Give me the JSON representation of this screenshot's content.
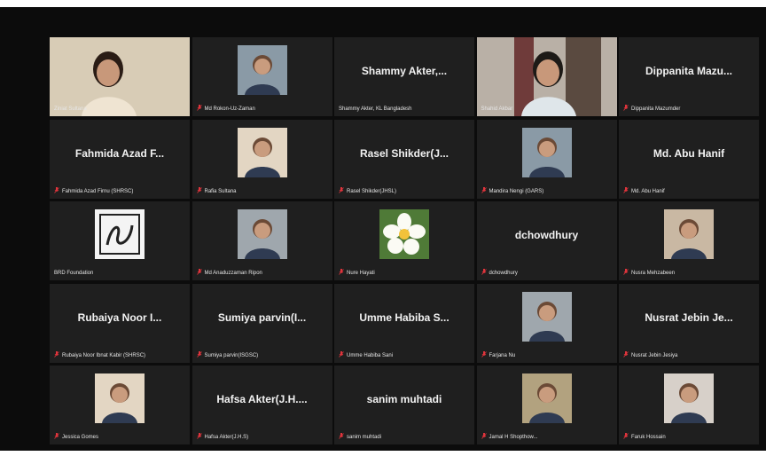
{
  "colors": {
    "background": "#0c0c0c",
    "tile": "#1f1f1f",
    "active_speaker_border": "#b9d35a",
    "muted_mic": "#e0343c"
  },
  "participants": [
    {
      "display": "",
      "label": "Ziniat Sultana",
      "muted": false,
      "video": "photo"
    },
    {
      "display": "",
      "label": "Md Rokon-Uz-Zaman",
      "muted": true,
      "video": "photo"
    },
    {
      "display": "Shammy Akter,...",
      "label": "Shammy Akter, KL Bangladesh",
      "muted": false,
      "video": "none"
    },
    {
      "display": "",
      "label": "Shahid Akbar",
      "muted": false,
      "video": "photo",
      "active": true
    },
    {
      "display": "Dippanita Mazu...",
      "label": "Dippanita Mazumder",
      "muted": true,
      "video": "none"
    },
    {
      "display": "Fahmida Azad F...",
      "label": "Fahmida Azad Firnu (SHRSC)",
      "muted": true,
      "video": "none"
    },
    {
      "display": "",
      "label": "Rafia Sultana",
      "muted": true,
      "video": "photo"
    },
    {
      "display": "Rasel Shikder(J...",
      "label": "Rasel Shikder(JHSL)",
      "muted": true,
      "video": "none"
    },
    {
      "display": "",
      "label": "Mandira Nengi (GARS)",
      "muted": true,
      "video": "photo"
    },
    {
      "display": "Md. Abu Hanif",
      "label": "Md. Abu Hanif",
      "muted": true,
      "video": "none"
    },
    {
      "display": "",
      "label": "BRD Foundation",
      "muted": false,
      "video": "logo"
    },
    {
      "display": "",
      "label": "Md Anaduzzaman Ripon",
      "muted": true,
      "video": "photo"
    },
    {
      "display": "",
      "label": "Nure Hayati",
      "muted": true,
      "video": "flower"
    },
    {
      "display": "dchowdhury",
      "label": "dchowdhury",
      "muted": true,
      "video": "none"
    },
    {
      "display": "",
      "label": "Nusra Mehzabeen",
      "muted": true,
      "video": "photo"
    },
    {
      "display": "Rubaiya Noor I...",
      "label": "Rubaiya Noor Ibnat Kabir (SHRSC)",
      "muted": true,
      "video": "none"
    },
    {
      "display": "Sumiya parvin(I...",
      "label": "Sumiya parvin(ISGSC)",
      "muted": true,
      "video": "none"
    },
    {
      "display": "Umme Habiba S...",
      "label": "Umme Habiba Sani",
      "muted": true,
      "video": "none"
    },
    {
      "display": "",
      "label": "Farjana Nu",
      "muted": true,
      "video": "photo"
    },
    {
      "display": "Nusrat Jebin Je...",
      "label": "Nusrat Jebin Jesiya",
      "muted": true,
      "video": "none"
    },
    {
      "display": "",
      "label": "Jessica Gomes",
      "muted": true,
      "video": "photo"
    },
    {
      "display": "Hafsa Akter(J.H....",
      "label": "Hafsa Akter(J.H.S)",
      "muted": true,
      "video": "none"
    },
    {
      "display": "sanim muhtadi",
      "label": "sanim muhtadi",
      "muted": true,
      "video": "none"
    },
    {
      "display": "",
      "label": "Jamal H Shopthow...",
      "muted": true,
      "video": "photo"
    },
    {
      "display": "",
      "label": "Faruk Hossain",
      "muted": true,
      "video": "photo"
    }
  ]
}
